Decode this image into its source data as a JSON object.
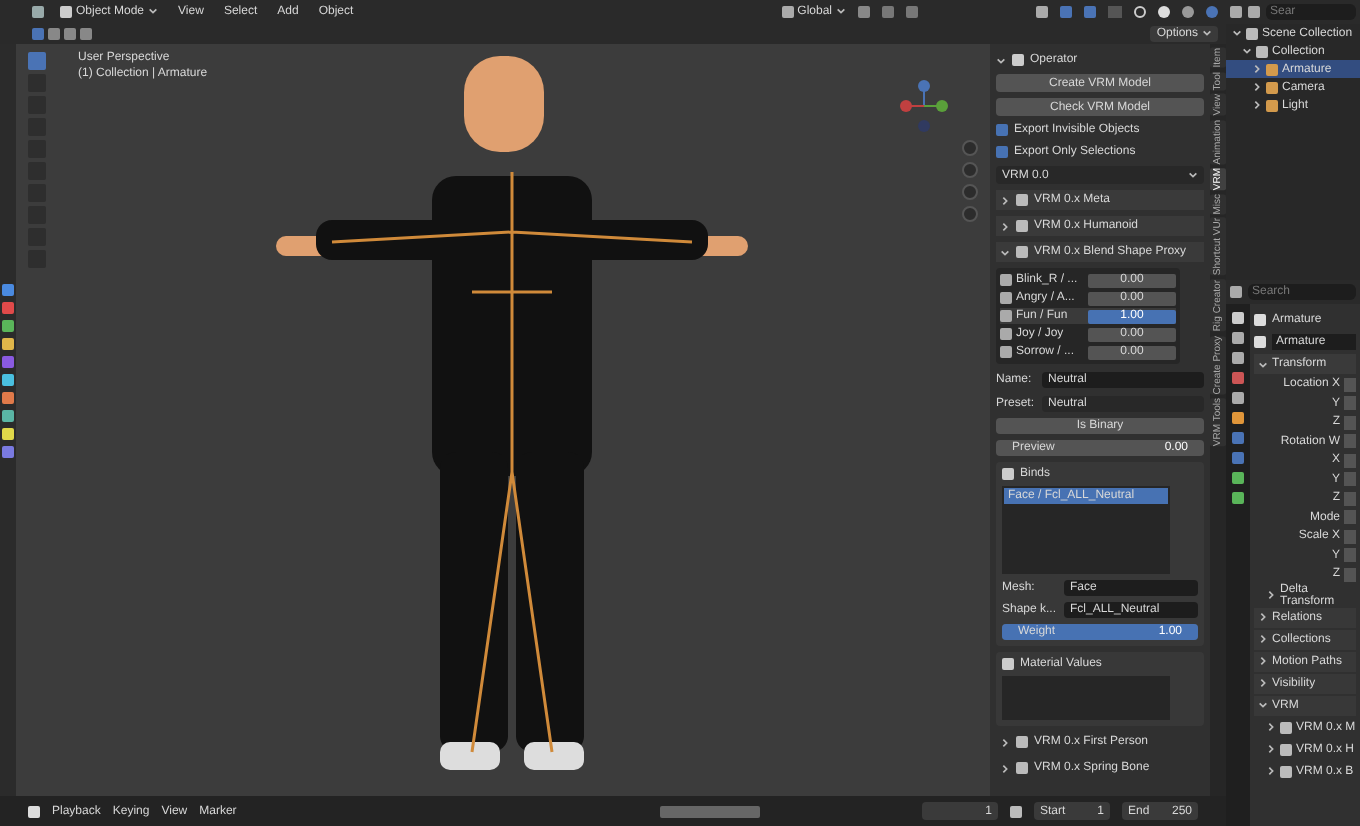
{
  "header": {
    "mode": "Object Mode",
    "menus": [
      "View",
      "Select",
      "Add",
      "Object"
    ],
    "orientation": "Global",
    "options": "Options"
  },
  "viewport": {
    "title": "User Perspective",
    "subtitle": "(1) Collection | Armature"
  },
  "side_tabs": [
    {
      "label": "Item",
      "selected": false
    },
    {
      "label": "Tool",
      "selected": false
    },
    {
      "label": "View",
      "selected": false
    },
    {
      "label": "Animation",
      "selected": false
    },
    {
      "label": "VRM",
      "selected": true
    },
    {
      "label": "Misc",
      "selected": false
    },
    {
      "label": "Shortcut VUr",
      "selected": false
    },
    {
      "label": "Rig Creator",
      "selected": false
    },
    {
      "label": "Create Proxy",
      "selected": false
    },
    {
      "label": "VRM Tools",
      "selected": false
    }
  ],
  "n_panel": {
    "operator": "Operator",
    "buttons": [
      "Create VRM Model",
      "Check VRM Model"
    ],
    "checkboxes": [
      {
        "label": "Export Invisible Objects",
        "checked": true
      },
      {
        "label": "Export Only Selections",
        "checked": true
      }
    ],
    "version": "VRM 0.0",
    "sections": [
      {
        "label": "VRM 0.x Meta",
        "expanded": false
      },
      {
        "label": "VRM 0.x Humanoid",
        "expanded": false
      },
      {
        "label": "VRM 0.x Blend Shape Proxy",
        "expanded": true
      }
    ],
    "blend_shapes": [
      {
        "label": "Blink_R / ...",
        "value": "0.00",
        "selected": false
      },
      {
        "label": "Angry / A...",
        "value": "0.00",
        "selected": false
      },
      {
        "label": "Fun / Fun",
        "value": "1.00",
        "selected": true
      },
      {
        "label": "Joy / Joy",
        "value": "0.00",
        "selected": false
      },
      {
        "label": "Sorrow / ...",
        "value": "0.00",
        "selected": false
      }
    ],
    "name": {
      "label": "Name:",
      "value": "Neutral"
    },
    "preset": {
      "label": "Preset:",
      "value": "Neutral"
    },
    "is_binary": "Is Binary",
    "preview": {
      "label": "Preview",
      "value": "0.00",
      "level": 0
    },
    "binds_title": "Binds",
    "binds": [
      {
        "label": "Face / Fcl_ALL_Neutral",
        "selected": true
      }
    ],
    "mesh": {
      "label": "Mesh:",
      "value": "Face"
    },
    "shape_key": {
      "label": "Shape k...",
      "value": "Fcl_ALL_Neutral"
    },
    "weight": {
      "label": "Weight",
      "value": "1.00",
      "level": 1
    },
    "material_values": "Material Values",
    "footer_sections": [
      {
        "label": "VRM 0.x First Person",
        "expanded": false
      },
      {
        "label": "VRM 0.x Spring Bone",
        "expanded": false
      }
    ]
  },
  "outliner": {
    "search_placeholder": "Sear",
    "tree": [
      {
        "label": "Scene Collection",
        "selected": false,
        "children": [
          {
            "label": "Collection",
            "selected": false,
            "expanded": true,
            "children": [
              {
                "label": "Armature",
                "selected": true
              },
              {
                "label": "Camera",
                "selected": false
              },
              {
                "label": "Light",
                "selected": false
              }
            ]
          }
        ]
      }
    ]
  },
  "properties": {
    "search_placeholder": "Search",
    "object": "Armature",
    "object_field": "Armature",
    "transform": "Transform",
    "fields": [
      "Location X",
      "Y",
      "Z",
      "Rotation W",
      "X",
      "Y",
      "Z",
      "Mode",
      "Scale X",
      "Y",
      "Z"
    ],
    "delta": "Delta Transform",
    "collapsed": [
      "Relations",
      "Collections",
      "Motion Paths",
      "Visibility"
    ],
    "vrm": "VRM",
    "vrm_children": [
      "VRM 0.x M",
      "VRM 0.x H",
      "VRM 0.x B"
    ]
  },
  "timeline": {
    "menus": [
      "Playback",
      "Keying",
      "View",
      "Marker"
    ],
    "frame": "1",
    "start_label": "Start",
    "start": "1",
    "end_label": "End",
    "end": "250"
  }
}
